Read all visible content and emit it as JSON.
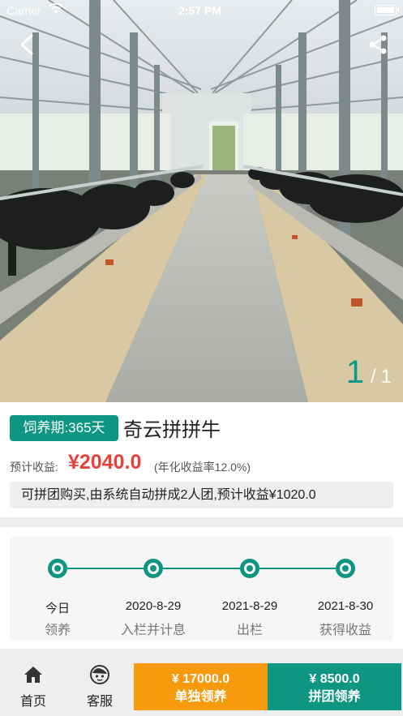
{
  "status_bar": {
    "carrier": "Carrier",
    "time": "2:57 PM",
    "battery_level": 1.0
  },
  "hero": {
    "photo_subject": "cattle barn",
    "pager_current": "1",
    "pager_separator": "/",
    "pager_total": "1"
  },
  "product": {
    "period_tag": "饲养期:365天",
    "name": "奇云拼拼牛",
    "income_label": "预计收益:",
    "income_value": "¥2040.0",
    "income_rate": "(年化收益率12.0%)",
    "group_note": "可拼团购买,由系统自动拼成2人团,预计收益¥1020.0"
  },
  "timeline": {
    "steps": [
      {
        "date": "今日",
        "label": "领养"
      },
      {
        "date": "2020-8-29",
        "label": "入栏并计息"
      },
      {
        "date": "2021-8-29",
        "label": "出栏"
      },
      {
        "date": "2021-8-30",
        "label": "获得收益"
      }
    ]
  },
  "bottom_bar": {
    "home_label": "首页",
    "service_label": "客服",
    "solo_price": "¥ 17000.0",
    "solo_label": "单独领养",
    "group_price": "¥ 8500.0",
    "group_label": "拼团领养"
  },
  "colors": {
    "accent_green": "#0f9683",
    "price_red": "#e7413a",
    "orange": "#f89a0e"
  }
}
